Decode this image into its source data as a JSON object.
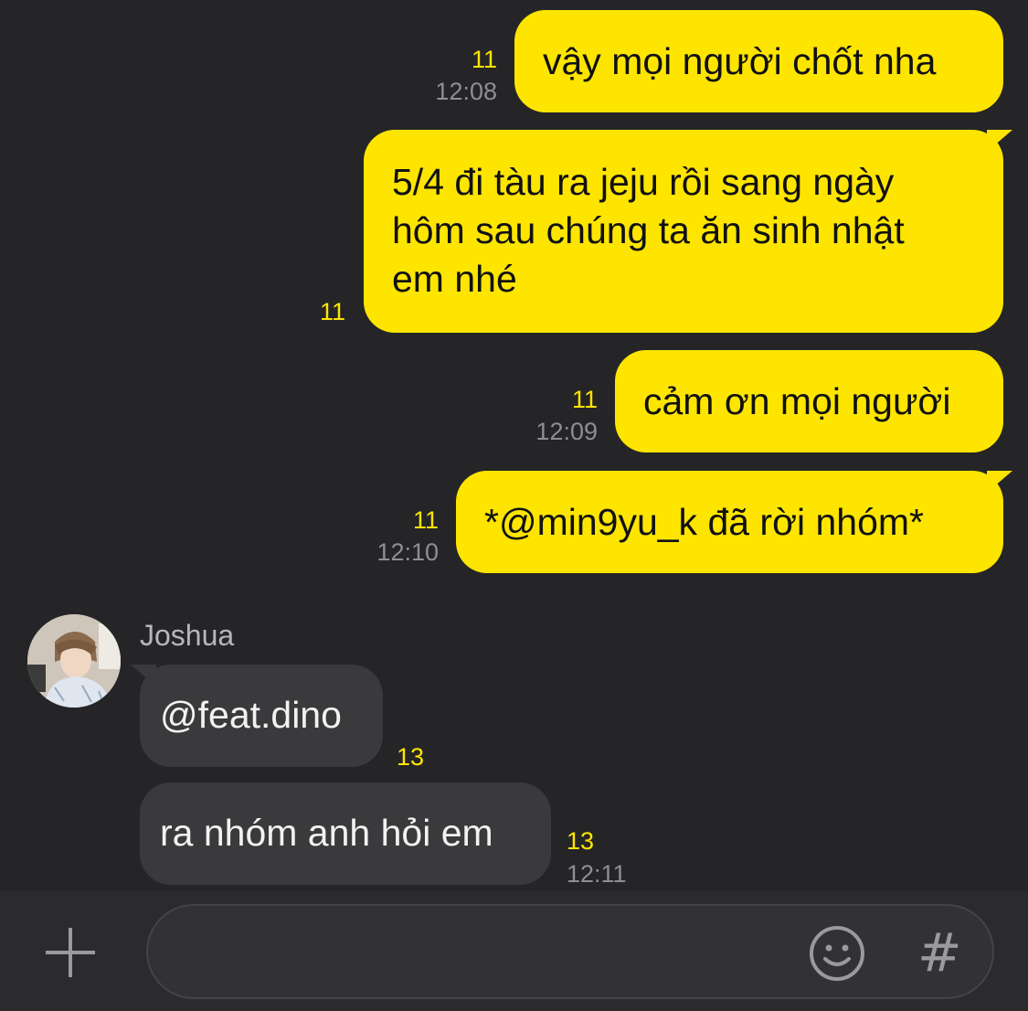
{
  "messages": [
    {
      "text": "vậy mọi người chốt nha",
      "unread": "11",
      "time": "12:08"
    },
    {
      "lines": [
        "5/4 đi tàu ra jeju rồi sang ngày",
        "hôm sau chúng ta ăn sinh nhật",
        "em nhé"
      ],
      "unread": "11"
    },
    {
      "text": "cảm ơn mọi người",
      "unread": "11",
      "time": "12:09"
    },
    {
      "text": "*@min9yu_k đã rời nhóm*",
      "unread": "11",
      "time": "12:10"
    },
    {
      "sender": "Joshua",
      "text": "@feat.dino",
      "unread": "13"
    },
    {
      "text": "ra nhóm anh hỏi em",
      "unread": "13",
      "time": "12:11"
    }
  ],
  "composer": {
    "placeholder": "",
    "plus_icon": "plus-icon",
    "emoji_icon": "smiley-icon",
    "hash_label": "#"
  },
  "colors": {
    "background": "#252527",
    "my_bubble": "#FEE500",
    "other_bubble": "#3a3a3c",
    "unread": "#FEE500"
  }
}
